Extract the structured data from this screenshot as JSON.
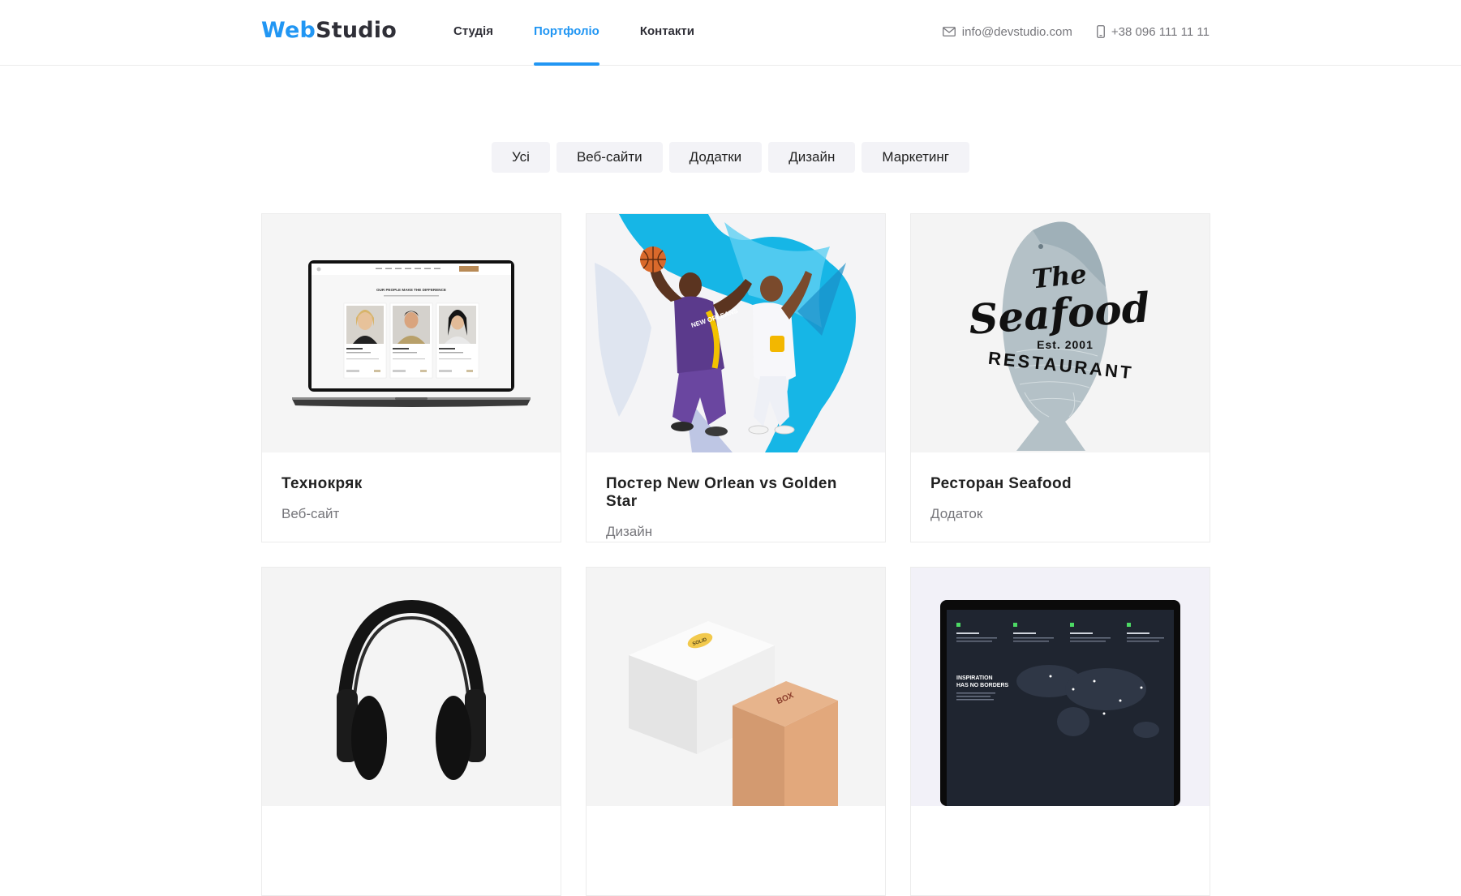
{
  "header": {
    "logo": {
      "accent": "Web",
      "rest": "Studio"
    },
    "nav": [
      {
        "label": "Студія"
      },
      {
        "label": "Портфоліо",
        "active": true
      },
      {
        "label": "Контакти"
      }
    ],
    "email": {
      "icon": "envelope-icon",
      "value": "info@devstudio.com"
    },
    "phone": {
      "icon": "phone-icon",
      "value": "+38 096 111 11 11"
    }
  },
  "filters": [
    "Усі",
    "Веб-сайти",
    "Додатки",
    "Дизайн",
    "Маркетинг"
  ],
  "portfolio": [
    {
      "title": "Технокряк",
      "category": "Веб-сайт",
      "image": "laptop-mockup-image"
    },
    {
      "title": "Постер New Orlean vs Golden Star",
      "category": "Дизайн",
      "image": "basketball-poster-image"
    },
    {
      "title": "Ресторан Seafood",
      "category": "Додаток",
      "image": "seafood-logo-image"
    },
    {
      "title": "",
      "category": "",
      "image": "headphones-image"
    },
    {
      "title": "",
      "category": "",
      "image": "packaging-boxes-image"
    },
    {
      "title": "",
      "category": "",
      "image": "dark-website-mockup-image"
    }
  ],
  "thumb_texts": {
    "laptop_heading": "OUR PEOPLE MAKE THE DIFFERENCE",
    "seafood_the": "The",
    "seafood_name": "Seafood",
    "seafood_est": "Est. 2001",
    "seafood_restaurant": "RESTAURANT",
    "poster_jersey": "NEW ORLEANS",
    "box_label_1": "SOLID",
    "box_label_2": "BOX",
    "dark_heading_1": "INSPIRATION",
    "dark_heading_2": "HAS NO BORDERS"
  },
  "colors": {
    "accent": "#2196f3",
    "text": "#212121",
    "muted": "#76767b",
    "filter_bg": "#f3f3f7"
  }
}
